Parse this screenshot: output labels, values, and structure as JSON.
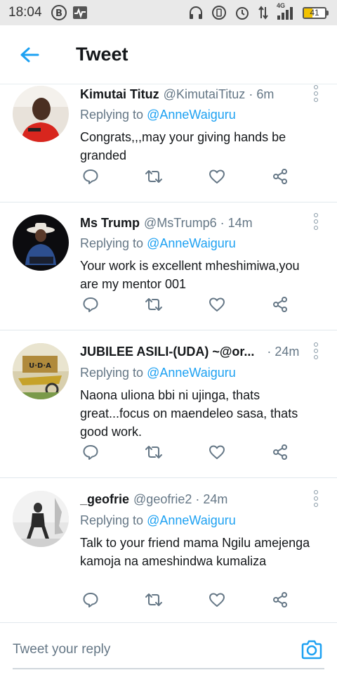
{
  "status_bar": {
    "time": "18:04",
    "network_type": "4G",
    "battery_percent": "41",
    "battery_level": 0.41
  },
  "header": {
    "title": "Tweet",
    "back_icon": "back-arrow-icon",
    "accent_color": "#1da1f2"
  },
  "tweets": [
    {
      "name": "Kimutai Tituz",
      "handle": "@KimutaiTituz",
      "separator": "·",
      "time": "6m",
      "replying_prefix": "Replying to",
      "replying_to": "@AnneWaiguru",
      "text": "Congrats,,,may your giving hands be granded"
    },
    {
      "name": "Ms Trump",
      "handle": "@MsTrump6",
      "separator": "·",
      "time": "14m",
      "replying_prefix": "Replying to",
      "replying_to": "@AnneWaiguru",
      "text": "Your work is excellent mheshimiwa,you are my mentor 001"
    },
    {
      "name": "JUBILEE ASILI-(UDA) ~@or...",
      "handle": "",
      "separator": "·",
      "time": "24m",
      "replying_prefix": "Replying to",
      "replying_to": "@AnneWaiguru",
      "text": "Naona uliona bbi ni ujinga, thats great...focus on maendeleo sasa, thats good work."
    },
    {
      "name": "_geofrie",
      "handle": "@geofrie2",
      "separator": "·",
      "time": "24m",
      "replying_prefix": "Replying to",
      "replying_to": "@AnneWaiguru",
      "text": "Talk to your friend mama Ngilu amejenga kamoja na ameshindwa kumaliza"
    }
  ],
  "reply_bar": {
    "placeholder": "Tweet your reply",
    "camera_icon": "camera-icon"
  }
}
